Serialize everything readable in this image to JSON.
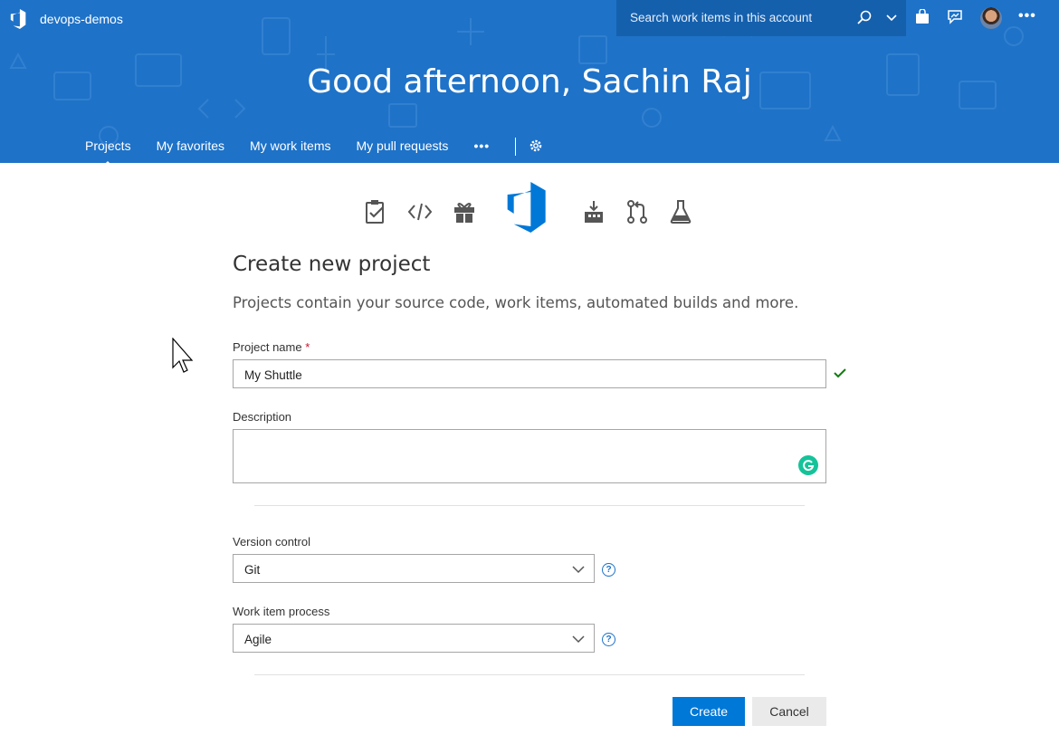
{
  "header": {
    "account_name": "devops-demos",
    "search_placeholder": "Search work items in this account",
    "greeting": "Good afternoon, Sachin Raj",
    "more_label": "•••"
  },
  "nav": {
    "items": [
      {
        "label": "Projects",
        "active": true
      },
      {
        "label": "My favorites",
        "active": false
      },
      {
        "label": "My work items",
        "active": false
      },
      {
        "label": "My pull requests",
        "active": false
      }
    ],
    "more_label": "•••"
  },
  "hub_icons": [
    "boards-icon",
    "code-icon",
    "artifacts-icon",
    "azure-devops-logo",
    "pipelines-icon",
    "repos-icon",
    "test-plans-icon"
  ],
  "form": {
    "title": "Create new project",
    "subtitle": "Projects contain your source code, work items, automated builds and more.",
    "project_name": {
      "label": "Project name",
      "required_mark": "*",
      "value": "My Shuttle"
    },
    "description": {
      "label": "Description",
      "value": ""
    },
    "version_control": {
      "label": "Version control",
      "value": "Git"
    },
    "work_item_process": {
      "label": "Work item process",
      "value": "Agile"
    },
    "help_glyph": "?",
    "create_label": "Create",
    "cancel_label": "Cancel"
  },
  "colors": {
    "banner": "#1e72c8",
    "primary_button": "#0078d7",
    "valid_check": "#107c10",
    "grammarly": "#15c39a"
  }
}
